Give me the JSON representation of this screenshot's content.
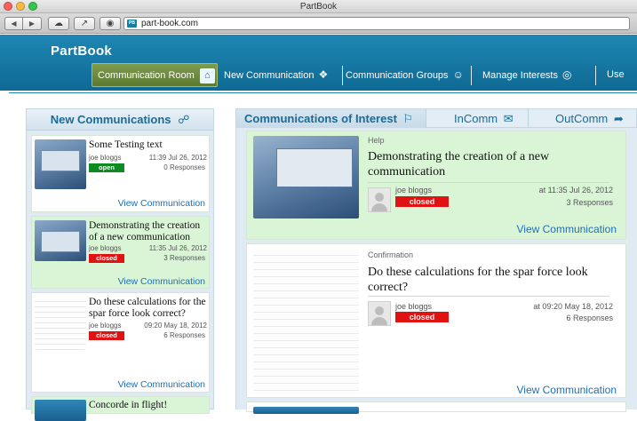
{
  "window": {
    "title": "PartBook"
  },
  "browser": {
    "url": "part-book.com",
    "favicon_text": "PB"
  },
  "app": {
    "brand": "PartBook",
    "nav": [
      {
        "label": "Communication Room",
        "icon": "home-icon"
      },
      {
        "label": "New Communication",
        "icon": "speech-bubble-icon"
      },
      {
        "label": "Communication Groups",
        "icon": "group-icon"
      },
      {
        "label": "Manage Interests",
        "icon": "lightbulb-icon"
      },
      {
        "label": "Use"
      }
    ]
  },
  "left_panel": {
    "title": "New Communications",
    "items": [
      {
        "title": "Some Testing text",
        "author": "joe bloggs",
        "time": "11:39 Jul 26, 2012",
        "status": "open",
        "responses": "0 Responses",
        "link": "View Communication"
      },
      {
        "title": "Demonstrating the creation of a new communication",
        "author": "joe bloggs",
        "time": "11:35 Jul 26, 2012",
        "status": "closed",
        "responses": "3 Responses",
        "link": "View Communication"
      },
      {
        "title": "Do these calculations for the spar force look correct?",
        "author": "joe bloggs",
        "time": "09:20 May 18, 2012",
        "status": "closed",
        "responses": "6 Responses",
        "link": "View Communication"
      },
      {
        "title": "Concorde in flight!"
      }
    ]
  },
  "right_panel": {
    "tabs": [
      "Communications of Interest",
      "InComm",
      "OutComm"
    ],
    "items": [
      {
        "category": "Help",
        "title": "Demonstrating the creation of a new communication",
        "author": "joe bloggs",
        "status": "closed",
        "time": "at 11:35 Jul 26, 2012",
        "responses": "3 Responses",
        "link": "View Communication"
      },
      {
        "category": "Confirmation",
        "title": "Do these calculations for the spar force look correct?",
        "author": "joe bloggs",
        "status": "closed",
        "time": "at 09:20 May 18, 2012",
        "responses": "6 Responses",
        "link": "View Communication"
      }
    ]
  },
  "colors": {
    "header": "#1480ad",
    "active_nav": "#6c8a3e",
    "highlight": "#d9f5d6",
    "open": "#0d8a22",
    "closed": "#e01212",
    "link": "#1f6fb5"
  }
}
